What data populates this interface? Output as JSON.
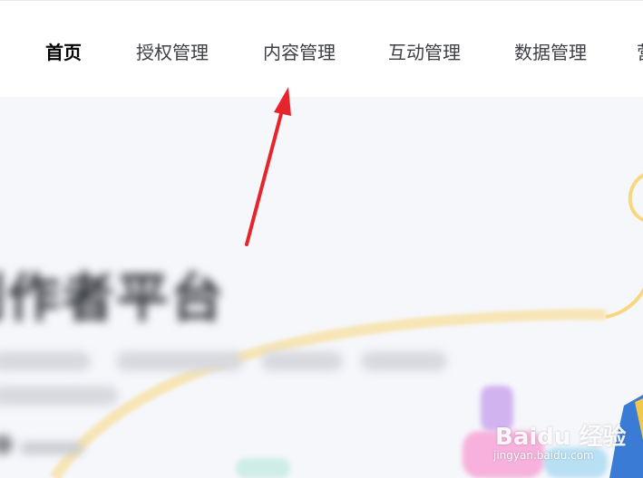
{
  "nav": {
    "items": [
      {
        "label": "首页",
        "active": true
      },
      {
        "label": "授权管理",
        "active": false
      },
      {
        "label": "内容管理",
        "active": false
      },
      {
        "label": "互动管理",
        "active": false
      },
      {
        "label": "数据管理",
        "active": false
      },
      {
        "label": "营",
        "active": false
      }
    ]
  },
  "hero": {
    "title": "创作者平台"
  },
  "watermark": {
    "logo": "Baidu 经验",
    "url": "jingyan.baidu.com"
  },
  "colors": {
    "accent_arrow": "#e5242b",
    "deco_yellow": "#f9d77e",
    "background": "#f6f7fb"
  }
}
